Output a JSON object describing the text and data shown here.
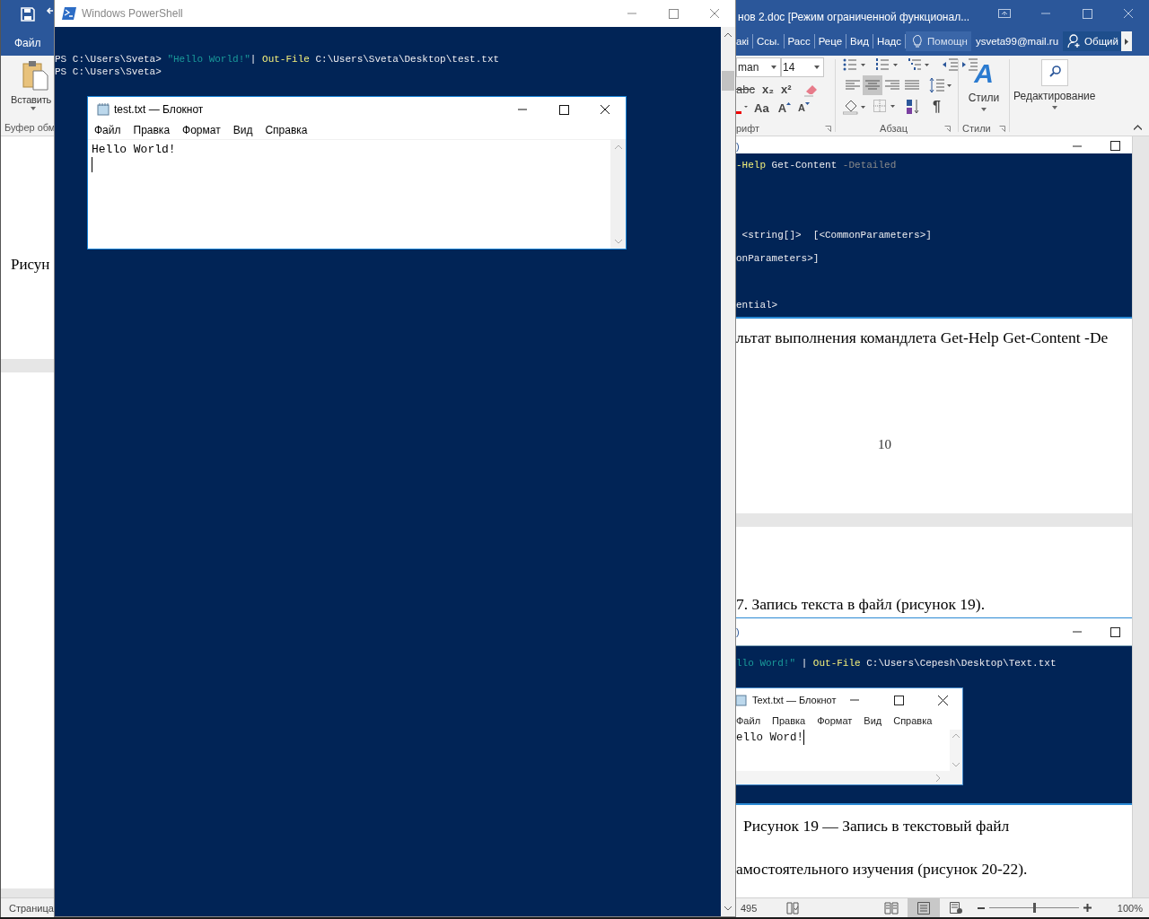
{
  "word_left": {
    "file_tab": "Файл",
    "paste_label": "Вставить",
    "group_label": "Буфер обм",
    "doc_text": "Рисун",
    "status": "Страница"
  },
  "powershell": {
    "title": "Windows PowerShell",
    "lines": [
      [
        {
          "kind": "plain",
          "text": "PS C:\\Users\\Sveta> "
        },
        {
          "kind": "string",
          "text": "\"Hello World!\""
        },
        {
          "kind": "plain",
          "text": "| "
        },
        {
          "kind": "command",
          "text": "Out-File"
        },
        {
          "kind": "plain",
          "text": " C:\\Users\\Sveta\\Desktop\\test.txt"
        }
      ],
      [
        {
          "kind": "plain",
          "text": "PS C:\\Users\\Sveta>"
        }
      ]
    ],
    "notepad": {
      "title": "test.txt — Блокнот",
      "menu": [
        "Файл",
        "Правка",
        "Формат",
        "Вид",
        "Справка"
      ],
      "content": "Hello World!"
    }
  },
  "word_right": {
    "title": "нов 2.doc [Режим ограниченной функционал...",
    "tabs": [
      "акі",
      "Ссы.",
      "Расс",
      "Реце",
      "Вид",
      "Надс"
    ],
    "tell_me": "Помощн",
    "account": "ysveta99@mail.ru",
    "share": "Общий",
    "font_name": "man",
    "font_size": "14",
    "font_glyphs": [
      {
        "kind": "strike",
        "text": "abc"
      },
      {
        "kind": "sub",
        "text": "x₂"
      },
      {
        "kind": "sup",
        "text": "x²"
      }
    ],
    "case_glyph": "Aa",
    "grow_glyph": "A",
    "shrink_glyph": "A",
    "pilcrow": "¶",
    "styles_glyph": "A",
    "align": [
      {
        "kind": "left",
        "selected": false
      },
      {
        "kind": "center",
        "selected": true
      },
      {
        "kind": "right",
        "selected": false
      },
      {
        "kind": "justify",
        "selected": false
      }
    ],
    "group_labels": [
      "рифт",
      "Абзац",
      "Стили"
    ],
    "styles_label": "Стили",
    "editing_label": "Редактирование",
    "image_1": {
      "title": ")",
      "lines": [
        [
          {
            "kind": "command",
            "text": "-Help"
          },
          {
            "kind": "plain",
            "text": " Get-Content"
          },
          {
            "kind": "param",
            "text": " -Detailed"
          }
        ],
        [
          {
            "kind": "plain",
            "text": " <string[]>  [<CommonParameters>]"
          }
        ],
        [
          {
            "kind": "plain",
            "text": "onParameters>]"
          }
        ],
        [
          {
            "kind": "plain",
            "text": "ential>"
          }
        ]
      ]
    },
    "caption_1": "льтат выполнения командлета Get-Help Get-Content -De",
    "page_number": "10",
    "paragraph_1": "7. Запись текста в файл (рисунок 19).",
    "image_2": {
      "title": ")",
      "line": [
        {
          "kind": "string",
          "text": "llo Word!\" "
        },
        {
          "kind": "plain",
          "text": "| "
        },
        {
          "kind": "command",
          "text": "Out-File"
        },
        {
          "kind": "plain",
          "text": " C:\\Users\\Cepesh\\Desktop\\Text.txt"
        }
      ],
      "notepad": {
        "title": "Text.txt — Блокнот",
        "menu": [
          "Файл",
          "Правка",
          "Формат",
          "Вид",
          "Справка"
        ],
        "content": "ello Word!"
      }
    },
    "caption_2": "Рисунок 19 — Запись в текстовый файл",
    "paragraph_2": "амостоятельного изучения (рисунок 20-22).",
    "status": {
      "words": "495",
      "views": [
        {
          "kind": "read",
          "selected": false
        },
        {
          "kind": "print",
          "selected": true
        },
        {
          "kind": "web",
          "selected": false
        }
      ],
      "zoom": {
        "level": 0.5,
        "reading": "100%"
      }
    }
  }
}
